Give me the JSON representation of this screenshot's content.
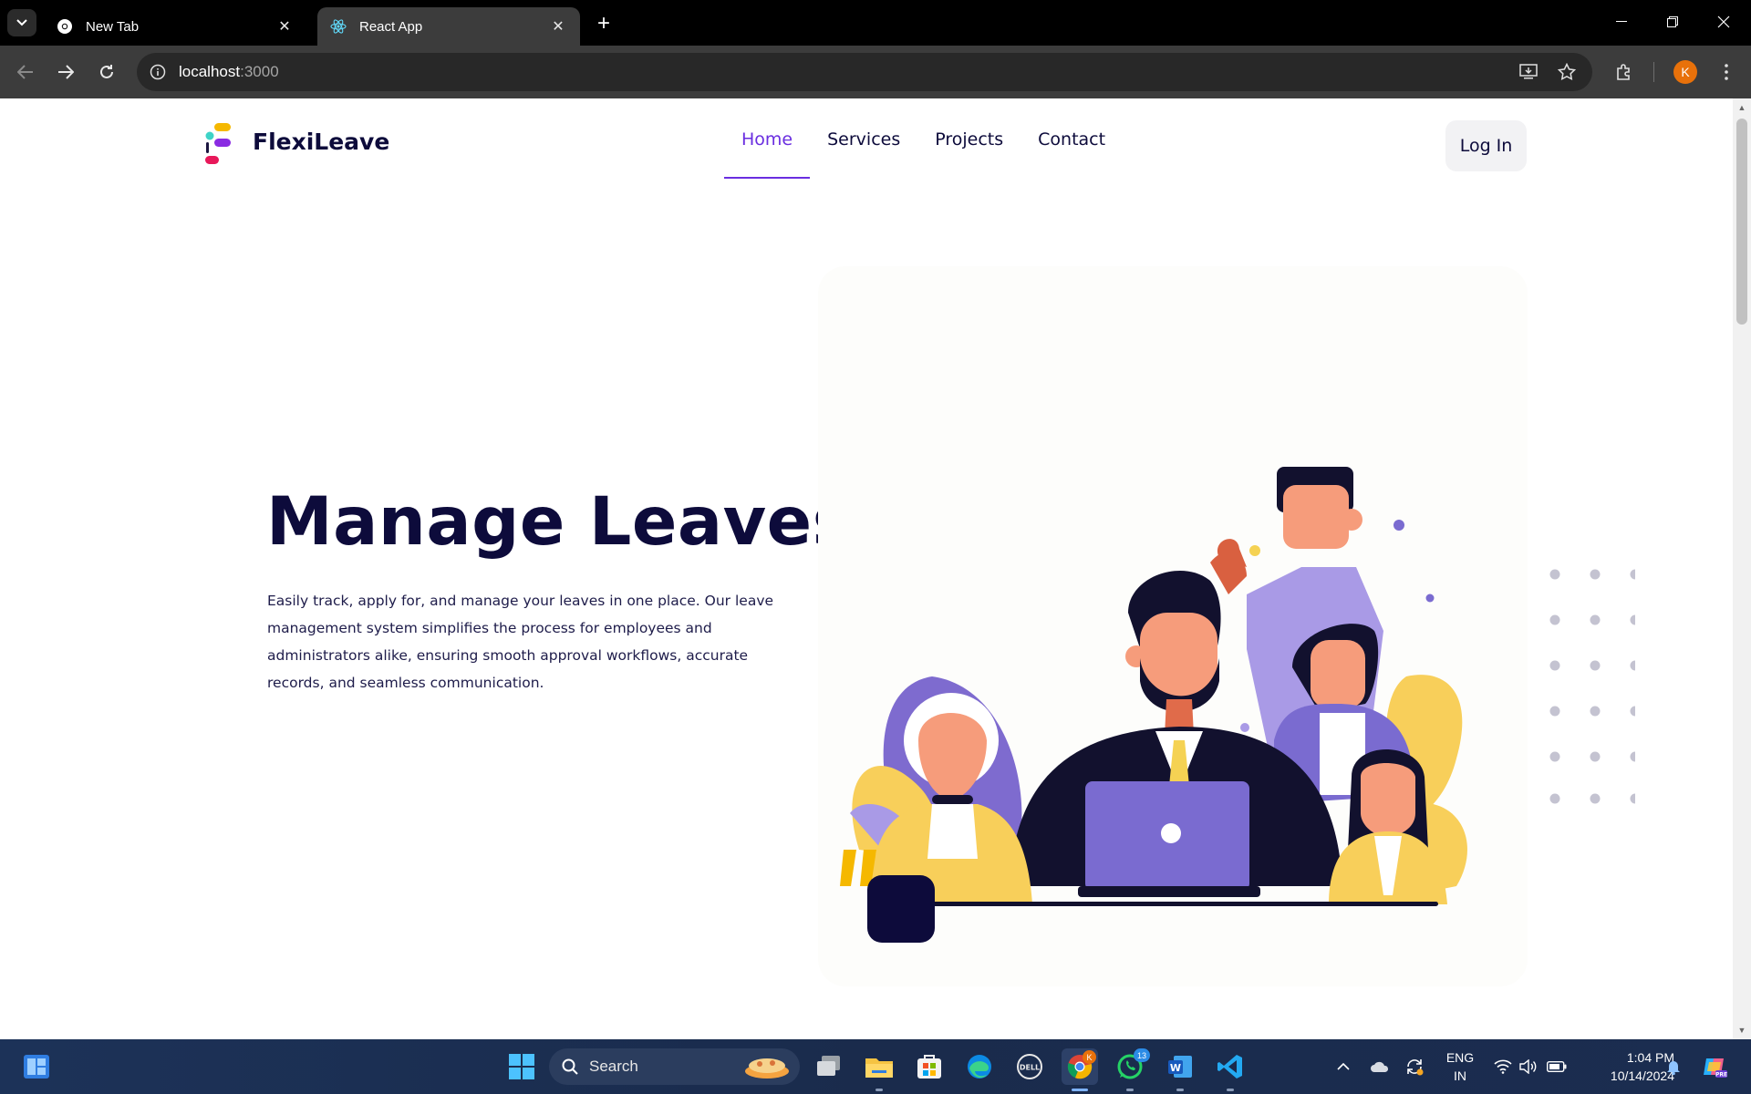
{
  "browser": {
    "tabs": [
      {
        "label": "New Tab",
        "icon": "chrome-icon",
        "active": false
      },
      {
        "label": "React App",
        "icon": "react-icon",
        "active": true
      }
    ],
    "url_host": "localhost",
    "url_port": ":3000",
    "profile_initial": "K"
  },
  "site": {
    "brand": "FlexiLeave",
    "nav": [
      {
        "label": "Home",
        "active": true
      },
      {
        "label": "Services",
        "active": false
      },
      {
        "label": "Projects",
        "active": false
      },
      {
        "label": "Contact",
        "active": false
      }
    ],
    "login_label": "Log In",
    "hero_title": "Manage Leaves",
    "hero_text": "Easily track, apply for, and manage your leaves in one place. Our leave management system simplifies the process for employees and administrators alike, ensuring smooth approval workflows, accurate records, and seamless communication.",
    "accent_color": "#6a2ee0",
    "text_color": "#0d0b3b"
  },
  "taskbar": {
    "search_placeholder": "Search",
    "whatsapp_badge": "13",
    "chrome_badge": "K",
    "lang_line1": "ENG",
    "lang_line2": "IN",
    "time": "1:04 PM",
    "date": "10/14/2024"
  }
}
